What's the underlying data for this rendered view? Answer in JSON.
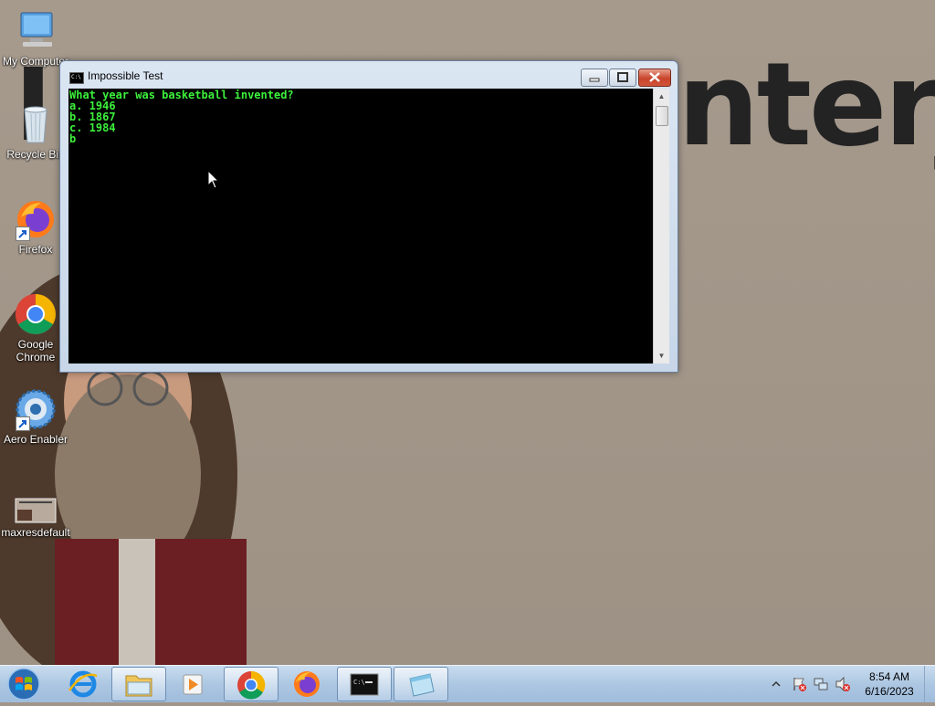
{
  "desktop": {
    "wallpaper_text": "nterje",
    "icons": [
      {
        "label": "My Computer"
      },
      {
        "label": "Recycle Bin"
      },
      {
        "label": "Firefox"
      },
      {
        "label": "Google Chrome"
      },
      {
        "label": "Aero Enabler"
      },
      {
        "label": "maxresdefault"
      }
    ]
  },
  "window": {
    "title": "Impossible Test",
    "app_icon_text": "C:\\",
    "console_lines": [
      "What year was basketball invented?",
      "a. 1946",
      "b. 1867",
      "c. 1984",
      "b"
    ]
  },
  "taskbar": {
    "items": [
      {
        "name": "start-button"
      },
      {
        "name": "internet-explorer"
      },
      {
        "name": "file-explorer"
      },
      {
        "name": "media-player"
      },
      {
        "name": "google-chrome"
      },
      {
        "name": "firefox"
      },
      {
        "name": "command-prompt"
      },
      {
        "name": "notepad"
      }
    ],
    "clock_time": "8:54 AM",
    "clock_date": "6/16/2023"
  },
  "colors": {
    "console_text": "#3cf03c",
    "console_bg": "#000000",
    "desktop_bg": "#a2968a"
  }
}
